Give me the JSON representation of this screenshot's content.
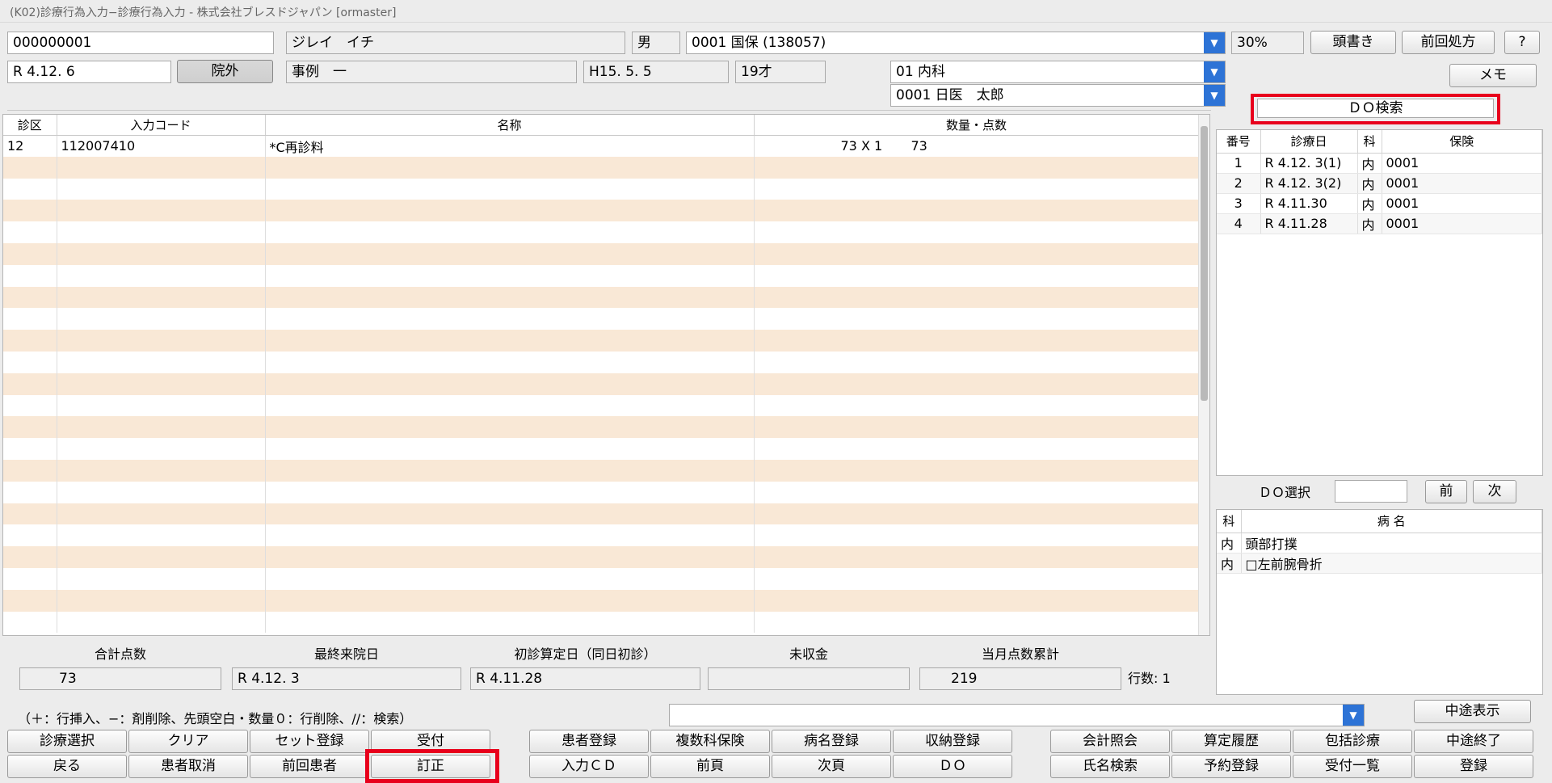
{
  "window": {
    "title": "(K02)診療行為入力−診療行為入力 - 株式会社ブレスドジャパン [ormaster]"
  },
  "patient": {
    "id": "000000001",
    "kana_name": "ジレイ　イチ",
    "sex": "男",
    "insurance": "0001 国保 (138057)",
    "rate": "30%",
    "date": "R 4.12. 6",
    "outside_label": "院外",
    "kanji_name": "事例　一",
    "birth": "H15. 5. 5",
    "age": "19才",
    "dept": "01 内科",
    "doctor": "0001 日医　太郎"
  },
  "top_buttons": {
    "atamagaki": "頭書き",
    "prev_rx": "前回処方",
    "help": "?",
    "memo": "メモ"
  },
  "do_search": {
    "label": "ＤＯ検索"
  },
  "main_table": {
    "columns": [
      "診区",
      "入力コード",
      "名称",
      "数量・点数"
    ],
    "rows": [
      {
        "kubun": "12",
        "code": "112007410",
        "name": "*C再診料",
        "qty": "73 X 1",
        "points": "73"
      }
    ]
  },
  "do_history": {
    "columns": [
      "番号",
      "診療日",
      "科",
      "保険"
    ],
    "rows": [
      {
        "no": "1",
        "date": "R 4.12. 3(1)",
        "ka": "内",
        "hoken": "0001"
      },
      {
        "no": "2",
        "date": "R 4.12. 3(2)",
        "ka": "内",
        "hoken": "0001"
      },
      {
        "no": "3",
        "date": "R 4.11.30",
        "ka": "内",
        "hoken": "0001"
      },
      {
        "no": "4",
        "date": "R 4.11.28",
        "ka": "内",
        "hoken": "0001"
      }
    ]
  },
  "do_select": {
    "label": "ＤＯ選択",
    "prev": "前",
    "next": "次"
  },
  "disease_table": {
    "columns": [
      "科",
      "病 名"
    ],
    "rows": [
      {
        "ka": "内",
        "name": "頭部打撲"
      },
      {
        "ka": "内",
        "name": "□左前腕骨折"
      }
    ]
  },
  "summary": {
    "total_label": "合計点数",
    "total_value": "73",
    "last_visit_label": "最終来院日",
    "last_visit_value": "R 4.12. 3",
    "first_visit_label": "初診算定日（同日初診）",
    "first_visit_value": "R 4.11.28",
    "unpaid_label": "未収金",
    "unpaid_value": "",
    "month_label": "当月点数累計",
    "month_value": "219",
    "rows_label": "行数:",
    "rows_value": "1"
  },
  "hint": "（＋：行挿入、−：剤削除、先頭空白・数量０：行削除、//：検索）",
  "midway_display": "中途表示",
  "footer": {
    "row1": [
      "診療選択",
      "クリア",
      "セット登録",
      "受付",
      "患者登録",
      "複数科保険",
      "病名登録",
      "収納登録",
      "会計照会",
      "算定履歴",
      "包括診療",
      "中途終了"
    ],
    "row2": [
      "戻る",
      "患者取消",
      "前回患者",
      "訂正",
      "入力ＣＤ",
      "前頁",
      "次頁",
      "ＤＯ",
      "氏名検索",
      "予約登録",
      "受付一覧",
      "登録"
    ]
  },
  "colors": {
    "highlight": "#e8001c",
    "stripe": "#f9e8d6",
    "dropdown": "#2d73d6"
  }
}
